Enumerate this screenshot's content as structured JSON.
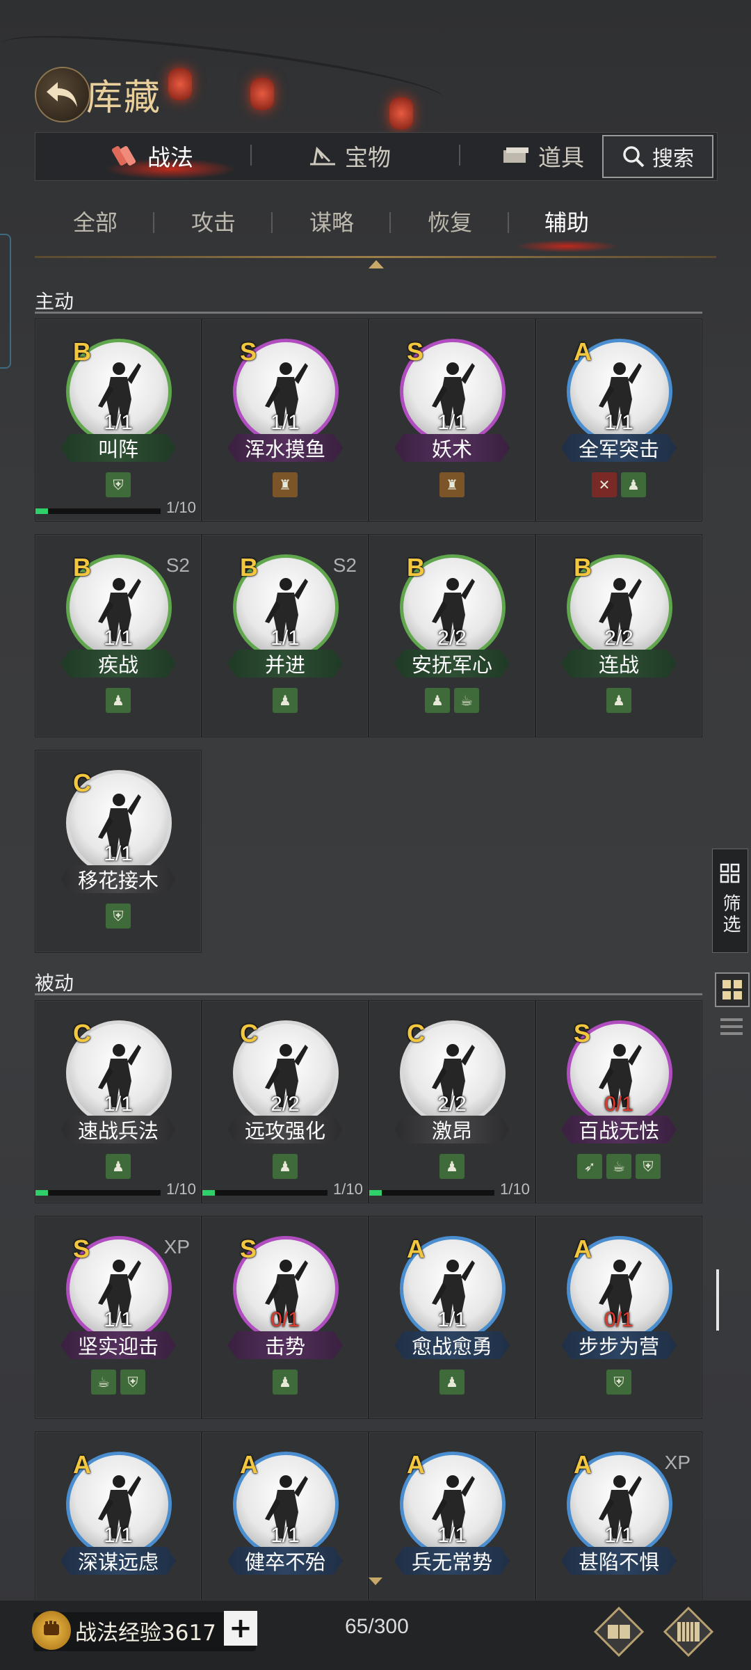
{
  "header": {
    "title": "库藏"
  },
  "top_tabs": [
    {
      "label": "战法",
      "active": true
    },
    {
      "label": "宝物",
      "active": false
    },
    {
      "label": "道具",
      "active": false
    }
  ],
  "search": {
    "label": "搜索"
  },
  "sub_tabs": [
    {
      "label": "全部",
      "active": false
    },
    {
      "label": "攻击",
      "active": false
    },
    {
      "label": "谋略",
      "active": false
    },
    {
      "label": "恢复",
      "active": false
    },
    {
      "label": "辅助",
      "active": true
    }
  ],
  "sections": {
    "active": {
      "label": "主动",
      "cards": [
        {
          "name": "叫阵",
          "grade": "B",
          "count": "1/1",
          "ring": "green",
          "types": [
            "shield"
          ],
          "progress": "1/10",
          "progress_fraction": 0.1
        },
        {
          "name": "浑水摸鱼",
          "grade": "S",
          "count": "1/1",
          "ring": "purple",
          "types": [
            "helmet"
          ]
        },
        {
          "name": "妖术",
          "grade": "S",
          "count": "1/1",
          "ring": "purple",
          "types": [
            "helmet"
          ]
        },
        {
          "name": "全军突击",
          "grade": "A",
          "count": "1/1",
          "ring": "blue",
          "types": [
            "swords",
            "soldier-up"
          ]
        },
        {
          "name": "疾战",
          "grade": "B",
          "count": "1/1",
          "ring": "green",
          "types": [
            "soldier-up"
          ],
          "season": "S2"
        },
        {
          "name": "并进",
          "grade": "B",
          "count": "1/1",
          "ring": "green",
          "types": [
            "soldier-up"
          ],
          "season": "S2"
        },
        {
          "name": "安抚军心",
          "grade": "B",
          "count": "2/2",
          "ring": "green",
          "types": [
            "soldier-up",
            "teapot"
          ]
        },
        {
          "name": "连战",
          "grade": "B",
          "count": "2/2",
          "ring": "green",
          "types": [
            "soldier-up"
          ]
        },
        {
          "name": "移花接木",
          "grade": "C",
          "count": "1/1",
          "ring": "white",
          "types": [
            "shield"
          ]
        }
      ]
    },
    "passive": {
      "label": "被动",
      "cards": [
        {
          "name": "速战兵法",
          "grade": "C",
          "count": "1/1",
          "ring": "white",
          "types": [
            "soldier-up"
          ],
          "progress": "1/10",
          "progress_fraction": 0.1
        },
        {
          "name": "远攻强化",
          "grade": "C",
          "count": "2/2",
          "ring": "white",
          "types": [
            "soldier-up"
          ],
          "progress": "1/10",
          "progress_fraction": 0.1
        },
        {
          "name": "激昂",
          "grade": "C",
          "count": "2/2",
          "ring": "white",
          "types": [
            "soldier-up"
          ],
          "progress": "1/10",
          "progress_fraction": 0.1
        },
        {
          "name": "百战无怯",
          "grade": "S",
          "count": "0/1",
          "ring": "purple",
          "types": [
            "arrow",
            "teapot",
            "shield"
          ]
        },
        {
          "name": "坚实迎击",
          "grade": "S",
          "count": "1/1",
          "ring": "purple",
          "types": [
            "teapot",
            "shield"
          ],
          "season": "XP"
        },
        {
          "name": "击势",
          "grade": "S",
          "count": "0/1",
          "ring": "purple",
          "types": [
            "soldier-up"
          ]
        },
        {
          "name": "愈战愈勇",
          "grade": "A",
          "count": "1/1",
          "ring": "blue",
          "types": [
            "soldier-up"
          ]
        },
        {
          "name": "步步为营",
          "grade": "A",
          "count": "0/1",
          "ring": "blue",
          "types": [
            "shield"
          ]
        },
        {
          "name": "深谋远虑",
          "grade": "A",
          "count": "1/1",
          "ring": "blue",
          "types": []
        },
        {
          "name": "健卒不殆",
          "grade": "A",
          "count": "1/1",
          "ring": "blue",
          "types": []
        },
        {
          "name": "兵无常势",
          "grade": "A",
          "count": "1/1",
          "ring": "blue",
          "types": []
        },
        {
          "name": "甚陷不惧",
          "grade": "A",
          "count": "1/1",
          "ring": "blue",
          "types": [],
          "season": "XP"
        }
      ]
    }
  },
  "side": {
    "filter_label": "筛选"
  },
  "bottom": {
    "exp_label": "战法经验3617",
    "plus": "+",
    "capacity": "65/300"
  },
  "icon_names": {
    "back": "back-arrow-icon",
    "search": "magnifier-icon",
    "filter": "grid-filter-icon",
    "grid_view": "grid-view-icon",
    "list_view": "list-view-icon",
    "treasure": "treasure-box-icon",
    "exp": "fist-icon"
  }
}
